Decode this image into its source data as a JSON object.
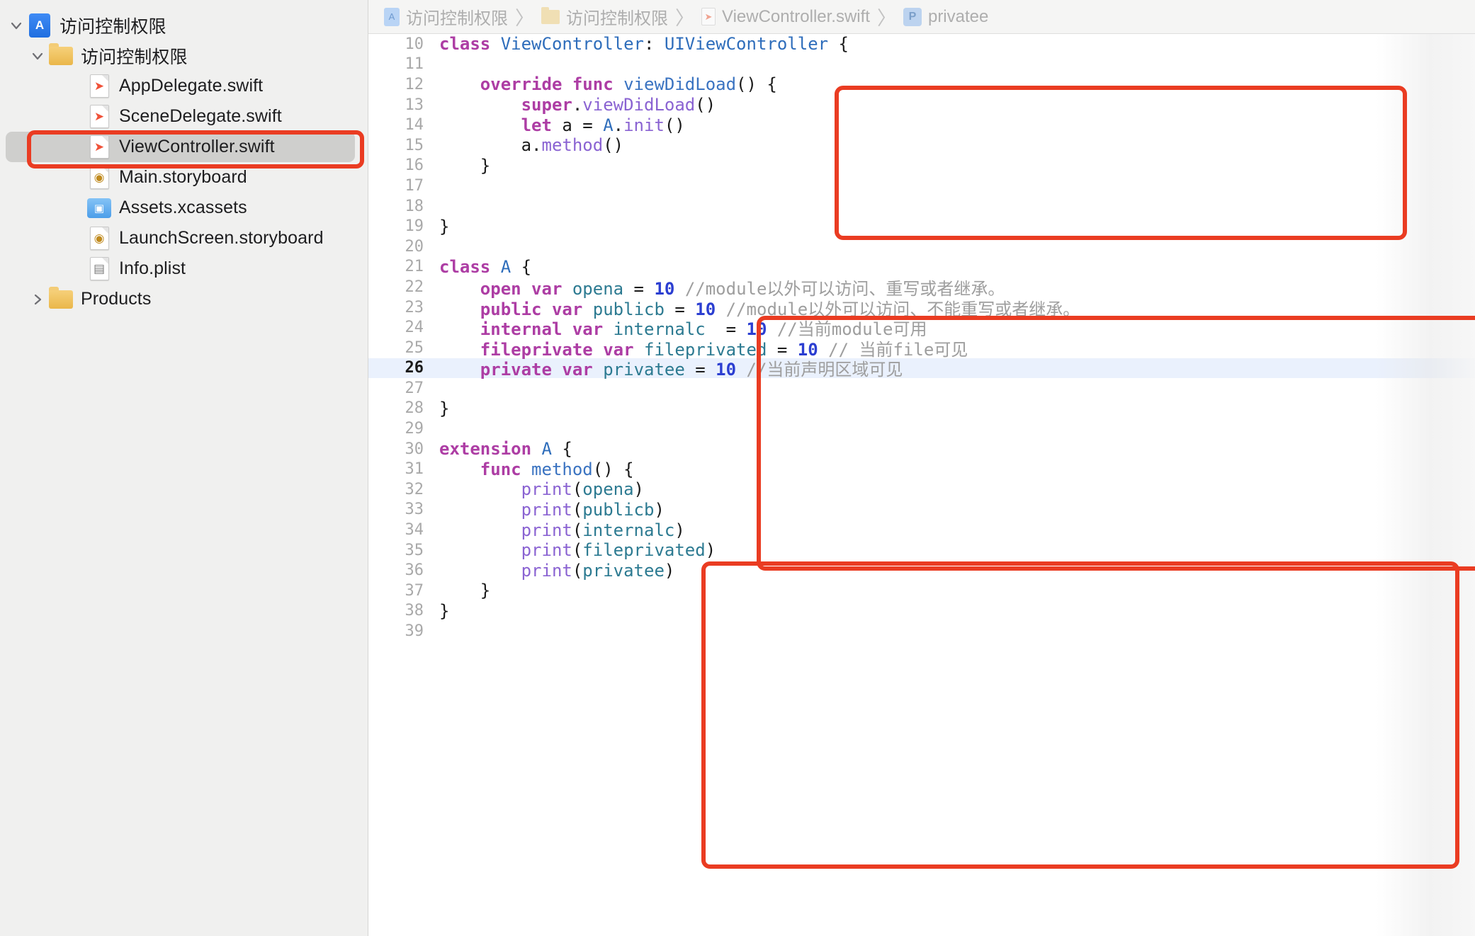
{
  "sidebar": {
    "items": [
      {
        "label": "访问控制权限",
        "icon": "project-icon",
        "level": 0,
        "disclosure": "expanded",
        "selected": false
      },
      {
        "label": "访问控制权限",
        "icon": "folder-icon",
        "level": 1,
        "disclosure": "expanded",
        "selected": false
      },
      {
        "label": "AppDelegate.swift",
        "icon": "swift-file-icon",
        "level": 2,
        "disclosure": "none",
        "selected": false
      },
      {
        "label": "SceneDelegate.swift",
        "icon": "swift-file-icon",
        "level": 2,
        "disclosure": "none",
        "selected": false
      },
      {
        "label": "ViewController.swift",
        "icon": "swift-file-icon",
        "level": 2,
        "disclosure": "none",
        "selected": true
      },
      {
        "label": "Main.storyboard",
        "icon": "storyboard-file-icon",
        "level": 2,
        "disclosure": "none",
        "selected": false
      },
      {
        "label": "Assets.xcassets",
        "icon": "assets-catalog-icon",
        "level": 2,
        "disclosure": "none",
        "selected": false
      },
      {
        "label": "LaunchScreen.storyboard",
        "icon": "storyboard-file-icon",
        "level": 2,
        "disclosure": "none",
        "selected": false
      },
      {
        "label": "Info.plist",
        "icon": "plist-file-icon",
        "level": 2,
        "disclosure": "none",
        "selected": false
      },
      {
        "label": "Products",
        "icon": "folder-icon",
        "level": 1,
        "disclosure": "collapsed",
        "selected": false
      }
    ]
  },
  "breadcrumb": {
    "separator": "〉",
    "items": [
      {
        "label": "访问控制权限",
        "icon": "project-icon"
      },
      {
        "label": "访问控制权限",
        "icon": "folder-icon"
      },
      {
        "label": "ViewController.swift",
        "icon": "swift-file-icon"
      },
      {
        "label": "privatee",
        "icon": "property-badge-icon",
        "badge": "P"
      }
    ]
  },
  "editor": {
    "current_line": 26,
    "first_visible_line": 10,
    "last_visible_line": 39,
    "language": "Swift",
    "lines": [
      {
        "n": 10,
        "tokens": [
          {
            "t": "class",
            "c": "kw"
          },
          {
            "t": " ",
            "c": "pln"
          },
          {
            "t": "ViewController",
            "c": "typ"
          },
          {
            "t": ": ",
            "c": "pln"
          },
          {
            "t": "UIViewController",
            "c": "typ"
          },
          {
            "t": " {",
            "c": "pln"
          }
        ]
      },
      {
        "n": 11,
        "tokens": []
      },
      {
        "n": 12,
        "tokens": [
          {
            "t": "    ",
            "c": "pln"
          },
          {
            "t": "override",
            "c": "kw"
          },
          {
            "t": " ",
            "c": "pln"
          },
          {
            "t": "func",
            "c": "kw"
          },
          {
            "t": " ",
            "c": "pln"
          },
          {
            "t": "viewDidLoad",
            "c": "fn"
          },
          {
            "t": "() {",
            "c": "pln"
          }
        ]
      },
      {
        "n": 13,
        "tokens": [
          {
            "t": "        ",
            "c": "pln"
          },
          {
            "t": "super",
            "c": "kw"
          },
          {
            "t": ".",
            "c": "pln"
          },
          {
            "t": "viewDidLoad",
            "c": "mth"
          },
          {
            "t": "()",
            "c": "pln"
          }
        ]
      },
      {
        "n": 14,
        "tokens": [
          {
            "t": "        ",
            "c": "pln"
          },
          {
            "t": "let",
            "c": "kw"
          },
          {
            "t": " a = ",
            "c": "pln"
          },
          {
            "t": "A",
            "c": "typ"
          },
          {
            "t": ".",
            "c": "pln"
          },
          {
            "t": "init",
            "c": "mth"
          },
          {
            "t": "()",
            "c": "pln"
          }
        ]
      },
      {
        "n": 15,
        "tokens": [
          {
            "t": "        a.",
            "c": "pln"
          },
          {
            "t": "method",
            "c": "mth"
          },
          {
            "t": "()",
            "c": "pln"
          }
        ]
      },
      {
        "n": 16,
        "tokens": [
          {
            "t": "    }",
            "c": "pln"
          }
        ]
      },
      {
        "n": 17,
        "tokens": []
      },
      {
        "n": 18,
        "tokens": []
      },
      {
        "n": 19,
        "tokens": [
          {
            "t": "}",
            "c": "pln"
          }
        ]
      },
      {
        "n": 20,
        "tokens": []
      },
      {
        "n": 21,
        "tokens": [
          {
            "t": "class",
            "c": "kw"
          },
          {
            "t": " ",
            "c": "pln"
          },
          {
            "t": "A",
            "c": "typ"
          },
          {
            "t": " {",
            "c": "pln"
          }
        ]
      },
      {
        "n": 22,
        "tokens": [
          {
            "t": "    ",
            "c": "pln"
          },
          {
            "t": "open",
            "c": "kw"
          },
          {
            "t": " ",
            "c": "pln"
          },
          {
            "t": "var",
            "c": "kw"
          },
          {
            "t": " ",
            "c": "pln"
          },
          {
            "t": "opena",
            "c": "prop"
          },
          {
            "t": " = ",
            "c": "pln"
          },
          {
            "t": "10",
            "c": "num"
          },
          {
            "t": " ",
            "c": "pln"
          },
          {
            "t": "//module以外可以访问、重写或者继承。",
            "c": "cmt"
          }
        ]
      },
      {
        "n": 23,
        "tokens": [
          {
            "t": "    ",
            "c": "pln"
          },
          {
            "t": "public",
            "c": "kw"
          },
          {
            "t": " ",
            "c": "pln"
          },
          {
            "t": "var",
            "c": "kw"
          },
          {
            "t": " ",
            "c": "pln"
          },
          {
            "t": "publicb",
            "c": "prop"
          },
          {
            "t": " = ",
            "c": "pln"
          },
          {
            "t": "10",
            "c": "num"
          },
          {
            "t": " ",
            "c": "pln"
          },
          {
            "t": "//module以外可以访问、不能重写或者继承。",
            "c": "cmt"
          }
        ]
      },
      {
        "n": 24,
        "tokens": [
          {
            "t": "    ",
            "c": "pln"
          },
          {
            "t": "internal",
            "c": "kw"
          },
          {
            "t": " ",
            "c": "pln"
          },
          {
            "t": "var",
            "c": "kw"
          },
          {
            "t": " ",
            "c": "pln"
          },
          {
            "t": "internalc",
            "c": "prop"
          },
          {
            "t": "  = ",
            "c": "pln"
          },
          {
            "t": "10",
            "c": "num"
          },
          {
            "t": " ",
            "c": "pln"
          },
          {
            "t": "//当前module可用",
            "c": "cmt"
          }
        ]
      },
      {
        "n": 25,
        "tokens": [
          {
            "t": "    ",
            "c": "pln"
          },
          {
            "t": "fileprivate",
            "c": "kw"
          },
          {
            "t": " ",
            "c": "pln"
          },
          {
            "t": "var",
            "c": "kw"
          },
          {
            "t": " ",
            "c": "pln"
          },
          {
            "t": "fileprivated",
            "c": "prop"
          },
          {
            "t": " = ",
            "c": "pln"
          },
          {
            "t": "10",
            "c": "num"
          },
          {
            "t": " ",
            "c": "pln"
          },
          {
            "t": "// 当前file可见",
            "c": "cmt"
          }
        ]
      },
      {
        "n": 26,
        "tokens": [
          {
            "t": "    ",
            "c": "pln"
          },
          {
            "t": "private",
            "c": "kw"
          },
          {
            "t": " ",
            "c": "pln"
          },
          {
            "t": "var",
            "c": "kw"
          },
          {
            "t": " ",
            "c": "pln"
          },
          {
            "t": "privatee",
            "c": "prop"
          },
          {
            "t": " = ",
            "c": "pln"
          },
          {
            "t": "10",
            "c": "num"
          },
          {
            "t": " ",
            "c": "pln"
          },
          {
            "t": "//当前声明区域可见",
            "c": "cmt"
          }
        ]
      },
      {
        "n": 27,
        "tokens": []
      },
      {
        "n": 28,
        "tokens": [
          {
            "t": "}",
            "c": "pln"
          }
        ]
      },
      {
        "n": 29,
        "tokens": []
      },
      {
        "n": 30,
        "tokens": [
          {
            "t": "extension",
            "c": "kw"
          },
          {
            "t": " ",
            "c": "pln"
          },
          {
            "t": "A",
            "c": "typ"
          },
          {
            "t": " {",
            "c": "pln"
          }
        ]
      },
      {
        "n": 31,
        "tokens": [
          {
            "t": "    ",
            "c": "pln"
          },
          {
            "t": "func",
            "c": "kw"
          },
          {
            "t": " ",
            "c": "pln"
          },
          {
            "t": "method",
            "c": "fn"
          },
          {
            "t": "() {",
            "c": "pln"
          }
        ]
      },
      {
        "n": 32,
        "tokens": [
          {
            "t": "        ",
            "c": "pln"
          },
          {
            "t": "print",
            "c": "mth"
          },
          {
            "t": "(",
            "c": "pln"
          },
          {
            "t": "opena",
            "c": "prop"
          },
          {
            "t": ")",
            "c": "pln"
          }
        ]
      },
      {
        "n": 33,
        "tokens": [
          {
            "t": "        ",
            "c": "pln"
          },
          {
            "t": "print",
            "c": "mth"
          },
          {
            "t": "(",
            "c": "pln"
          },
          {
            "t": "publicb",
            "c": "prop"
          },
          {
            "t": ")",
            "c": "pln"
          }
        ]
      },
      {
        "n": 34,
        "tokens": [
          {
            "t": "        ",
            "c": "pln"
          },
          {
            "t": "print",
            "c": "mth"
          },
          {
            "t": "(",
            "c": "pln"
          },
          {
            "t": "internalc",
            "c": "prop"
          },
          {
            "t": ")",
            "c": "pln"
          }
        ]
      },
      {
        "n": 35,
        "tokens": [
          {
            "t": "        ",
            "c": "pln"
          },
          {
            "t": "print",
            "c": "mth"
          },
          {
            "t": "(",
            "c": "pln"
          },
          {
            "t": "fileprivated",
            "c": "prop"
          },
          {
            "t": ")",
            "c": "pln"
          }
        ]
      },
      {
        "n": 36,
        "tokens": [
          {
            "t": "        ",
            "c": "pln"
          },
          {
            "t": "print",
            "c": "mth"
          },
          {
            "t": "(",
            "c": "pln"
          },
          {
            "t": "privatee",
            "c": "prop"
          },
          {
            "t": ")",
            "c": "pln"
          }
        ]
      },
      {
        "n": 37,
        "tokens": [
          {
            "t": "    }",
            "c": "pln"
          }
        ]
      },
      {
        "n": 38,
        "tokens": [
          {
            "t": "}",
            "c": "pln"
          }
        ]
      },
      {
        "n": 39,
        "tokens": []
      }
    ]
  },
  "annotations": {
    "color": "#ea3c22",
    "rects": [
      {
        "name": "viewDidLoad-block-highlight",
        "lines": "12-16"
      },
      {
        "name": "class-a-block-highlight",
        "lines": "20-28"
      },
      {
        "name": "extension-a-block-highlight",
        "lines": "29-39"
      },
      {
        "name": "selected-file-highlight",
        "target": "ViewController.swift"
      }
    ]
  },
  "colors": {
    "annotation_red": "#ea3c22",
    "keyword": "#ad3da4",
    "type": "#2e6dbb",
    "function": "#3a73c1",
    "method": "#8a63d2",
    "property": "#2c7a91",
    "number": "#2b3ed1",
    "comment": "#9e9e9e",
    "current_line_bg": "#eaf1fd",
    "sidebar_bg": "#f0f0ef",
    "selection_bg": "#cfcfcd"
  }
}
